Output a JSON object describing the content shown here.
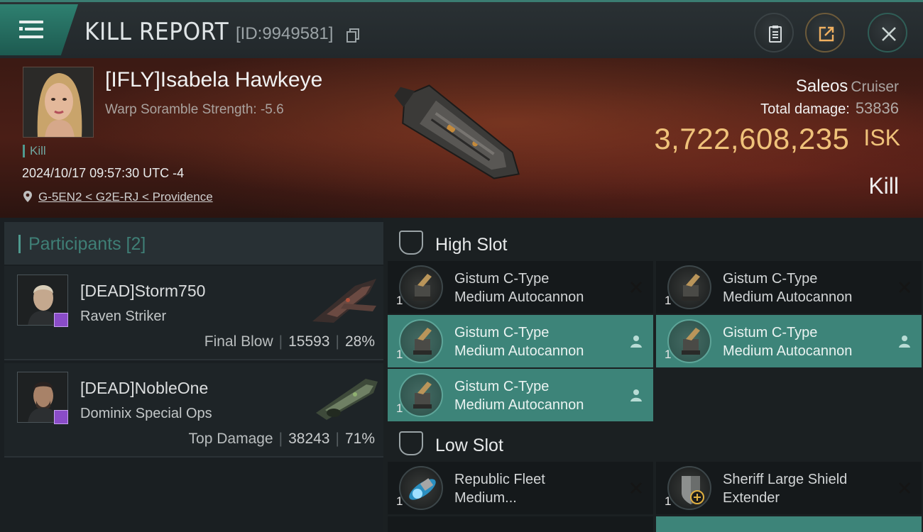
{
  "header": {
    "title": "KILL REPORT",
    "report_id": "[ID:9949581]"
  },
  "victim": {
    "name": "[IFLY]Isabela Hawkeye",
    "warp": "Warp Soramble Strength: -5.6",
    "tag": "Kill",
    "datetime": "2024/10/17 09:57:30 UTC -4",
    "location": "G-5EN2 < G2E-RJ < Providence",
    "ship": "Saleos",
    "ship_class": "Cruiser",
    "damage_label": "Total damage:",
    "damage_value": "53836",
    "isk_value": "3,722,608,235",
    "isk_unit": "ISK",
    "result": "Kill"
  },
  "participants": {
    "title": "Participants [2]",
    "items": [
      {
        "name": "[DEAD]Storm750",
        "ship": "Raven Striker",
        "label": "Final Blow",
        "damage": "15593",
        "percent": "28%"
      },
      {
        "name": "[DEAD]NobleOne",
        "ship": "Dominix Special Ops",
        "label": "Top Damage",
        "damage": "38243",
        "percent": "71%"
      }
    ]
  },
  "fitting": {
    "high_slot": "High Slot",
    "low_slot": "Low Slot",
    "high": [
      {
        "line1": "Gistum C-Type",
        "line2": "Medium Autocannon",
        "qty": "1",
        "state": "destroyed"
      },
      {
        "line1": "Gistum C-Type",
        "line2": "Medium Autocannon",
        "qty": "1",
        "state": "destroyed"
      },
      {
        "line1": "Gistum C-Type",
        "line2": "Medium Autocannon",
        "qty": "1",
        "state": "dropped"
      },
      {
        "line1": "Gistum C-Type",
        "line2": "Medium Autocannon",
        "qty": "1",
        "state": "dropped"
      },
      {
        "line1": "Gistum C-Type",
        "line2": "Medium Autocannon",
        "qty": "1",
        "state": "dropped"
      }
    ],
    "low": [
      {
        "line1": "Republic Fleet",
        "line2": "Medium...",
        "qty": "1",
        "state": "destroyed"
      },
      {
        "line1": "Sheriff Large Shield",
        "line2": "Extender",
        "qty": "1",
        "state": "destroyed"
      }
    ]
  },
  "colors": {
    "accent": "#3d8479",
    "isk": "#efc27a",
    "banner": "#4a1e16"
  }
}
